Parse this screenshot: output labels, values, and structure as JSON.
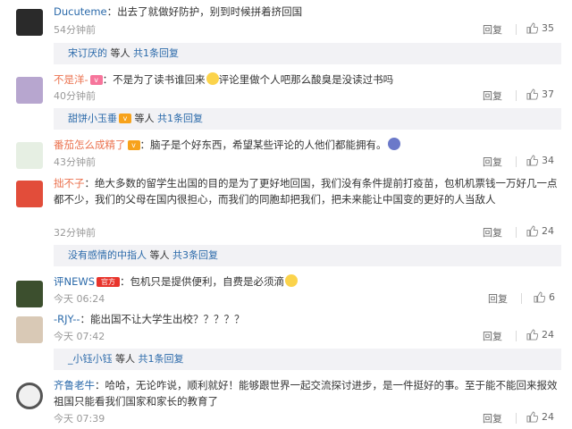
{
  "comments": [
    {
      "user": "Ducuteme",
      "text": "出去了就做好防护，别到时候拼着挤回国",
      "time": "54分钟前",
      "reply_label": "回复",
      "likes": "35",
      "sub": {
        "user": "宋订厌的",
        "tail": " 等人 ",
        "more": "共1条回复"
      }
    },
    {
      "user": "不是洋-",
      "text": "不是为了读书谁回来",
      "text_after_emoji": "评论里做个人吧那么酸臭是没读过书吗",
      "time": "40分钟前",
      "reply_label": "回复",
      "likes": "37",
      "sub": {
        "user": "甜饼小玉垂",
        "tail": " 等人 ",
        "more": "共1条回复"
      }
    },
    {
      "user": "番茄怎么成精了",
      "text": "脑子是个好东西，希望某些评论的人他们都能拥有。",
      "time": "43分钟前",
      "reply_label": "回复",
      "likes": "34"
    },
    {
      "user": "拙不子",
      "text": "绝大多数的留学生出国的目的是为了更好地回国，我们没有条件提前打疫苗，包机机票钱一万好几一点都不少，我们的父母在国内很担心，而我们的同胞却把我们，把未来能让中国变的更好的人当敌人",
      "time": "32分钟前",
      "reply_label": "回复",
      "likes": "24",
      "sub": {
        "user": "没有感情的中指人",
        "tail": " 等人 ",
        "more": "共3条回复"
      }
    },
    {
      "user": "评NEWS",
      "badge": "官方",
      "text": "包机只是提供便利，自费是必须滴",
      "time": "今天 06:24",
      "reply_label": "回复",
      "likes": "6"
    },
    {
      "user": "-RJY--",
      "text": "能出国不让大学生出校？？？？？",
      "time": "今天 07:42",
      "reply_label": "回复",
      "likes": "24",
      "sub": {
        "user": "_小钰小钰",
        "tail": " 等人 ",
        "more": "共1条回复"
      }
    },
    {
      "user": "齐鲁老牛",
      "text": "哈哈，无论咋说，顺利就好！能够跟世界一起交流探讨进步，是一件挺好的事。至于能不能回来报效祖国只能看我们国家和家长的教育了",
      "time": "今天 07:39",
      "reply_label": "回复",
      "likes": "24"
    }
  ],
  "colors": {
    "username_orange": "#eb7350",
    "username_blue": "#2b6aaa",
    "subbar_bg": "#f2f2f5",
    "time_gray": "#999999"
  }
}
